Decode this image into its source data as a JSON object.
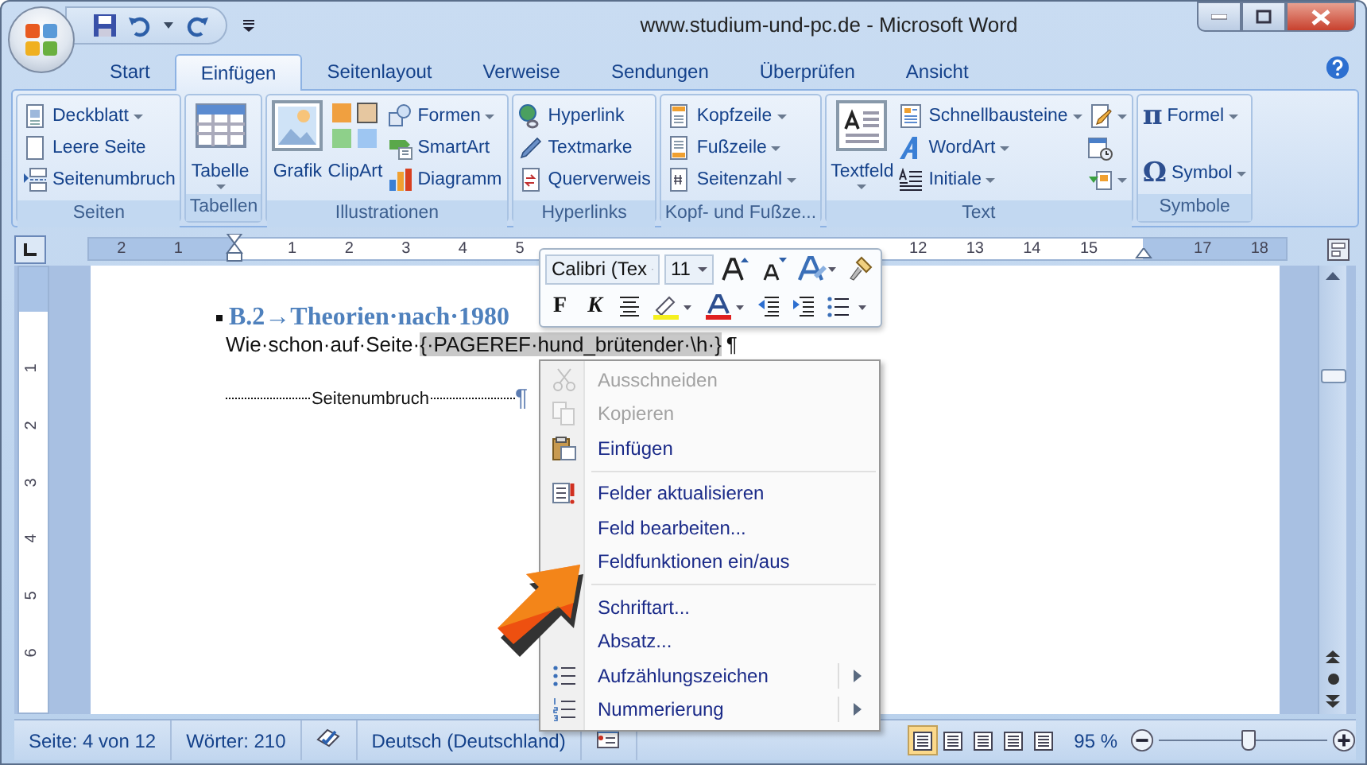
{
  "window": {
    "title": "www.studium-und-pc.de - Microsoft Word"
  },
  "tabs": [
    {
      "label": "Start",
      "selected": false
    },
    {
      "label": "Einfügen",
      "selected": true
    },
    {
      "label": "Seitenlayout",
      "selected": false
    },
    {
      "label": "Verweise",
      "selected": false
    },
    {
      "label": "Sendungen",
      "selected": false
    },
    {
      "label": "Überprüfen",
      "selected": false
    },
    {
      "label": "Ansicht",
      "selected": false
    }
  ],
  "ribbon": {
    "groups": [
      {
        "label": "Seiten",
        "controls": [
          {
            "kind": "small",
            "label": "Deckblatt",
            "dropdown": true
          },
          {
            "kind": "small",
            "label": "Leere Seite",
            "dropdown": false
          },
          {
            "kind": "small",
            "label": "Seitenumbruch",
            "dropdown": false
          }
        ]
      },
      {
        "label": "Tabellen",
        "controls": [
          {
            "kind": "large",
            "label": "Tabelle",
            "dropdown": true
          }
        ]
      },
      {
        "label": "Illustrationen",
        "controls": [
          {
            "kind": "large",
            "label": "Grafik",
            "dropdown": false
          },
          {
            "kind": "large",
            "label": "ClipArt",
            "dropdown": false
          },
          {
            "kind": "small",
            "label": "Formen",
            "dropdown": true
          },
          {
            "kind": "small",
            "label": "SmartArt",
            "dropdown": false
          },
          {
            "kind": "small",
            "label": "Diagramm",
            "dropdown": false
          }
        ]
      },
      {
        "label": "Hyperlinks",
        "controls": [
          {
            "kind": "small",
            "label": "Hyperlink",
            "dropdown": false
          },
          {
            "kind": "small",
            "label": "Textmarke",
            "dropdown": false
          },
          {
            "kind": "small",
            "label": "Querverweis",
            "dropdown": false
          }
        ]
      },
      {
        "label": "Kopf- und Fußze...",
        "controls": [
          {
            "kind": "small",
            "label": "Kopfzeile",
            "dropdown": true
          },
          {
            "kind": "small",
            "label": "Fußzeile",
            "dropdown": true
          },
          {
            "kind": "small",
            "label": "Seitenzahl",
            "dropdown": true
          }
        ]
      },
      {
        "label": "Text",
        "controls": [
          {
            "kind": "large",
            "label": "Textfeld",
            "dropdown": true
          },
          {
            "kind": "small",
            "label": "Schnellbausteine",
            "dropdown": true
          },
          {
            "kind": "small",
            "label": "WordArt",
            "dropdown": true
          },
          {
            "kind": "small",
            "label": "Initiale",
            "dropdown": true
          },
          {
            "kind": "icon",
            "dropdown": true
          },
          {
            "kind": "icon",
            "dropdown": false
          },
          {
            "kind": "icon",
            "dropdown": true
          }
        ]
      },
      {
        "label": "Symbole",
        "controls": [
          {
            "kind": "small",
            "label": "Formel",
            "glyph": "π",
            "dropdown": true
          },
          {
            "kind": "small",
            "label": "Symbol",
            "glyph": "Ω",
            "dropdown": true
          }
        ]
      }
    ]
  },
  "ruler": {
    "left_numbers": [
      "2",
      "1"
    ],
    "numbers": [
      "1",
      "2",
      "3",
      "4",
      "5",
      "12",
      "13",
      "14",
      "15",
      "17",
      "18"
    ]
  },
  "vertical_ruler": {
    "numbers": [
      "1",
      "2",
      "3",
      "4",
      "5",
      "6"
    ]
  },
  "document": {
    "heading": "B.2→Theorien·nach·1980",
    "paragraph": {
      "text": "Wie·schon·auf·Seite·",
      "field_code": "{·PAGEREF·hund_brütender·\\h·}",
      "mark": "¶"
    },
    "page_break": {
      "label": "Seitenumbruch",
      "mark": "¶"
    }
  },
  "mini_toolbar": {
    "font": "Calibri (Tex",
    "size": "11",
    "bold": "F",
    "italic": "K"
  },
  "context_menu": {
    "items": [
      {
        "kind": "item",
        "label": "Ausschneiden",
        "disabled": true,
        "submenu": false
      },
      {
        "kind": "item",
        "label": "Kopieren",
        "disabled": true,
        "submenu": false
      },
      {
        "kind": "item",
        "label": "Einfügen",
        "disabled": false,
        "submenu": false
      },
      {
        "kind": "separator"
      },
      {
        "kind": "item",
        "label": "Felder aktualisieren",
        "disabled": false,
        "submenu": false
      },
      {
        "kind": "item",
        "label": "Feld bearbeiten...",
        "disabled": false,
        "submenu": false
      },
      {
        "kind": "item",
        "label": "Feldfunktionen ein/aus",
        "disabled": false,
        "submenu": false
      },
      {
        "kind": "separator"
      },
      {
        "kind": "item",
        "label": "Schriftart...",
        "disabled": false,
        "submenu": false
      },
      {
        "kind": "item",
        "label": "Absatz...",
        "disabled": false,
        "submenu": false
      },
      {
        "kind": "item",
        "label": "Aufzählungszeichen",
        "disabled": false,
        "submenu": true
      },
      {
        "kind": "item",
        "label": "Nummerierung",
        "disabled": false,
        "submenu": true
      }
    ]
  },
  "status_bar": {
    "page": "Seite: 4 von 12",
    "words": "Wörter: 210",
    "language": "Deutsch (Deutschland)",
    "views": [
      {
        "selected": true
      },
      {
        "selected": false
      },
      {
        "selected": false
      },
      {
        "selected": false
      },
      {
        "selected": false
      }
    ],
    "zoom": "95 %",
    "zoom_slider": {
      "level": 0.53
    }
  }
}
